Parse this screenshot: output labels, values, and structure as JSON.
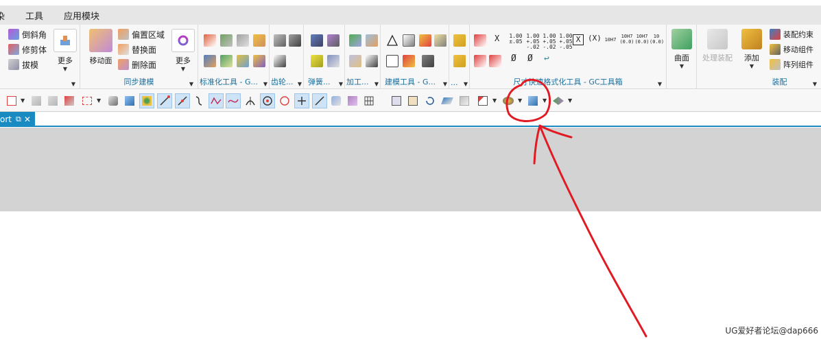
{
  "menubar": {
    "items": [
      "染",
      "工具",
      "应用模块"
    ]
  },
  "ribbon": {
    "group1": {
      "buttons": [
        "倒斜角",
        "修剪体",
        "拔模"
      ],
      "more_label": "更多"
    },
    "sync": {
      "move_face_label": "移动面",
      "buttons": [
        "偏置区域",
        "替换面",
        "删除面"
      ],
      "more_label": "更多",
      "label": "同步建模"
    },
    "group_labels": {
      "standard": "标准化工具 - G...",
      "gear": "齿轮...",
      "spring": "弹簧...",
      "machining": "加工...",
      "modeling": "建模工具 - G...",
      "p": "..."
    },
    "dim": {
      "label": "尺寸快速格式化工具 - GC工具箱",
      "text_icons": [
        "1.00\n±.05",
        "1.00\n+.05\n-.02",
        "1.00\n+.05\n-.02",
        "1.00\n+.05\n-.05",
        "10H7",
        "10H7\n(0.0)",
        "10H7\n(0.0)",
        "10\n(0.0)"
      ],
      "symbols": [
        "X",
        "X",
        "(X)",
        "Ø",
        "Ø",
        "↩"
      ]
    },
    "surface": {
      "label": "曲面"
    },
    "process": {
      "label": "处理装配"
    },
    "assembly": {
      "add_label": "添加",
      "buttons": [
        "装配约束",
        "移动组件",
        "阵列组件"
      ],
      "label": "装配"
    }
  },
  "tabbar": {
    "tab_label": "ort"
  },
  "watermark": "UG爱好者论坛@dap666",
  "colors": {
    "accent": "#1a8bc2",
    "annotation": "#e01b24"
  }
}
